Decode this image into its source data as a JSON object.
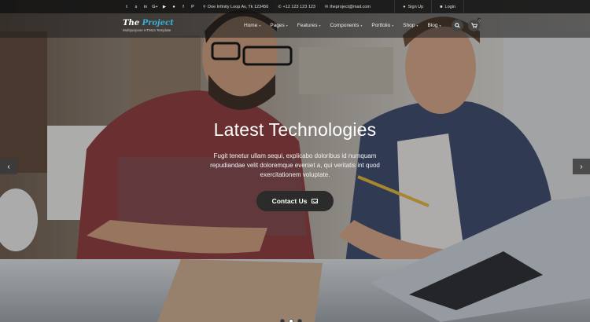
{
  "topbar": {
    "social_icons": [
      "twitter-icon",
      "skype-icon",
      "linkedin-icon",
      "googleplus-icon",
      "youtube-icon",
      "flickr-icon",
      "facebook-icon",
      "pinterest-icon"
    ],
    "social_glyphs": [
      "t",
      "s",
      "in",
      "G+",
      "▶",
      "●",
      "f",
      "P"
    ],
    "address": "One Infinity Loop Av, Tk 123456",
    "phone": "+12 123 123 123",
    "email": "theproject@mail.com",
    "signup_label": "Sign Up",
    "login_label": "Login"
  },
  "navbar": {
    "logo_part1": "The ",
    "logo_part2": "Project",
    "tagline": "Multipurpose HTML5 Template",
    "menu": [
      {
        "label": "Home",
        "caret": "▾"
      },
      {
        "label": "Pages",
        "caret": "▾"
      },
      {
        "label": "Features",
        "caret": "▾"
      },
      {
        "label": "Components",
        "caret": "▾"
      },
      {
        "label": "Portfolio",
        "caret": "▾"
      },
      {
        "label": "Shop",
        "caret": "▾"
      },
      {
        "label": "Blog",
        "caret": "▾"
      }
    ],
    "cart_count": "0"
  },
  "hero": {
    "title": "Latest Technologies",
    "text": "Fugit tenetur ullam sequi, explicabo doloribus id numquam repudiandae velit doloremque eveniet a, qui veritatis int quod exercitationem voluptate.",
    "cta_label": "Contact Us",
    "prev_glyph": "‹",
    "next_glyph": "›",
    "slides_total": 3,
    "active_slide": 1
  },
  "colors": {
    "accent": "#3aaed8",
    "topbar_bg": "#141414",
    "cta_bg": "#2b2b2b"
  }
}
